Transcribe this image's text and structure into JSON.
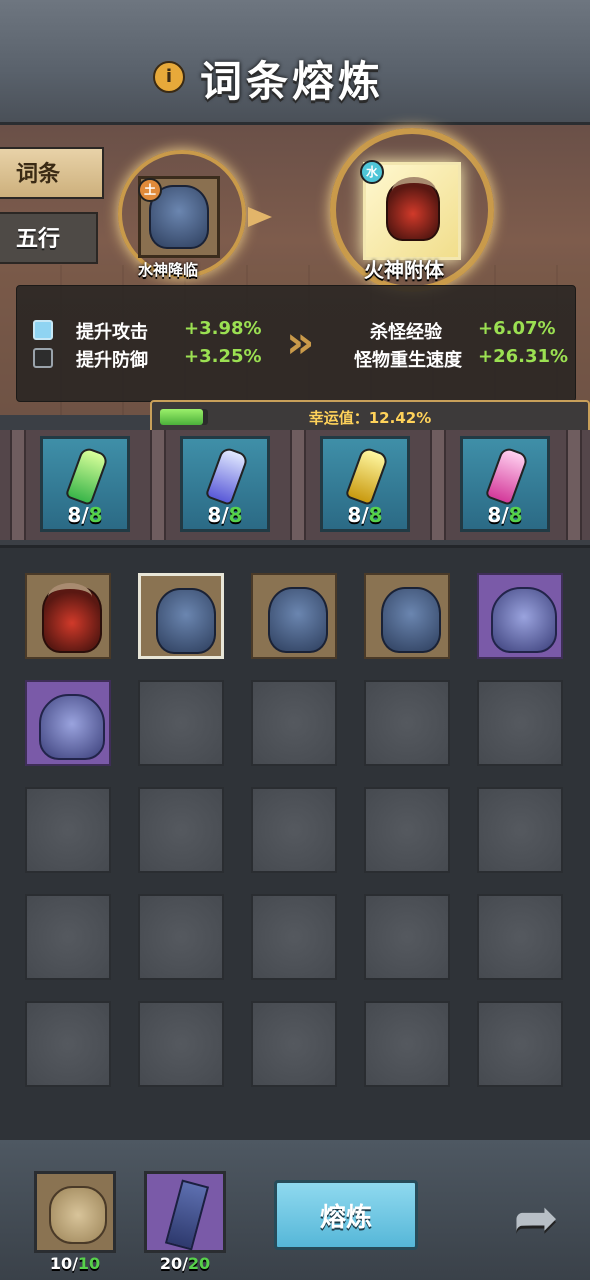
{
  "header": {
    "title": "词条熔炼",
    "info_icon": "info-icon"
  },
  "tabs": [
    {
      "label": "词条",
      "active": true
    },
    {
      "label": "五行",
      "active": false
    }
  ],
  "transfer": {
    "source": {
      "name": "水神降临",
      "element": "土",
      "icon": "blue-armor-icon"
    },
    "target": {
      "name": "火神附体",
      "element": "水",
      "icon": "red-armor-icon"
    }
  },
  "stats": {
    "left": [
      {
        "label": "提升攻击",
        "value": "+3.98%",
        "checked": true
      },
      {
        "label": "提升防御",
        "value": "+3.25%",
        "checked": false
      }
    ],
    "right": [
      {
        "label": "杀怪经验",
        "value": "+6.07%"
      },
      {
        "label": "怪物重生速度",
        "value": "+26.31%"
      }
    ]
  },
  "luck": {
    "label": "幸运值：12.42%",
    "value": 0.1242
  },
  "gems": [
    {
      "color": "green",
      "count": "8",
      "max": "8"
    },
    {
      "color": "blue",
      "count": "8",
      "max": "8"
    },
    {
      "color": "yellow",
      "count": "8",
      "max": "8"
    },
    {
      "color": "pink",
      "count": "8",
      "max": "8"
    }
  ],
  "inventory": {
    "items": [
      {
        "type": "red-armor",
        "frame": "tan",
        "selected": false
      },
      {
        "type": "blue-armor",
        "frame": "tan",
        "selected": true
      },
      {
        "type": "blue-armor",
        "frame": "tan",
        "selected": false
      },
      {
        "type": "blue-armor",
        "frame": "tan",
        "selected": false
      },
      {
        "type": "purple-armor",
        "frame": "purple",
        "selected": false
      },
      {
        "type": "purple-armor",
        "frame": "purple",
        "selected": false
      }
    ],
    "total_slots": 25
  },
  "bottom": {
    "stone": {
      "count": "10",
      "max": "10",
      "icon": "stone-icon"
    },
    "scroll": {
      "count": "20",
      "max": "20",
      "icon": "scroll-icon"
    },
    "smelt_label": "熔炼",
    "share_icon": "share-arrow-icon"
  }
}
